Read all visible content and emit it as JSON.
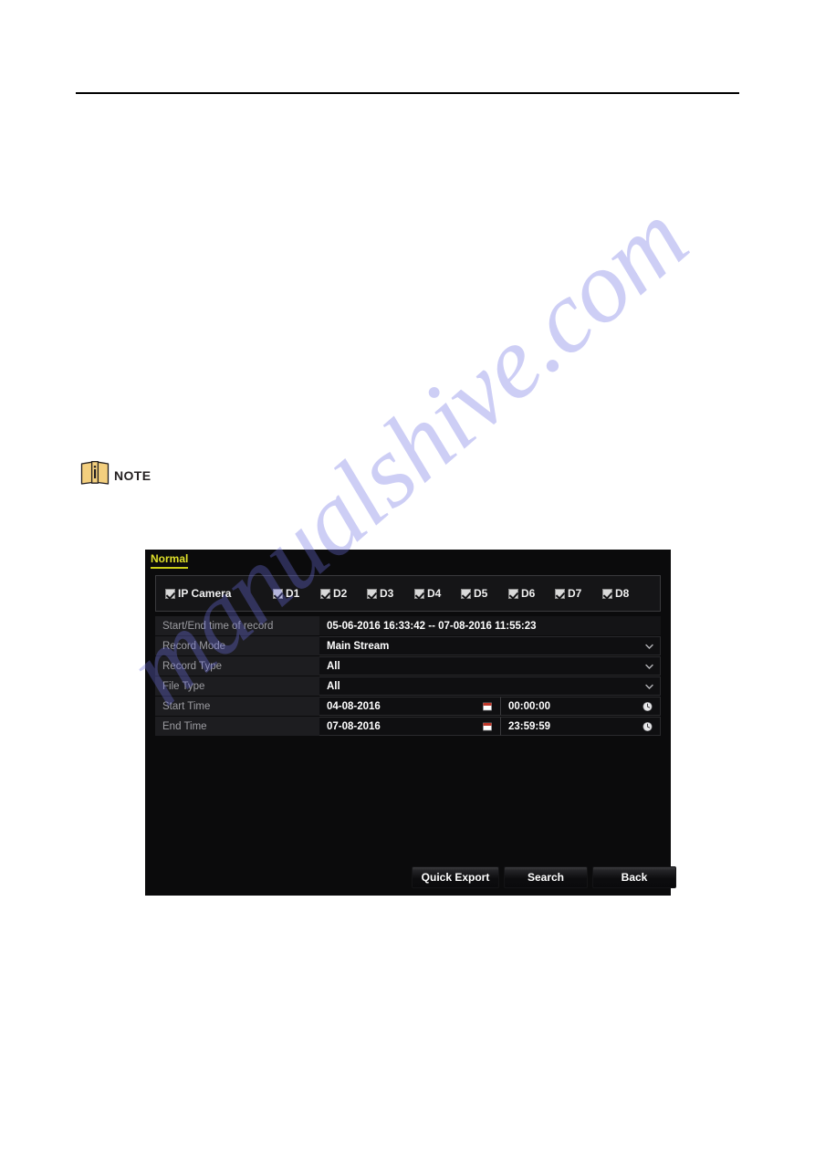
{
  "document": {
    "note_label": "NOTE",
    "note_icon": "book-info-icon",
    "watermark": "manualshive.com"
  },
  "nvr": {
    "tab": {
      "label": "Normal",
      "accent_color": "#dfe02a"
    },
    "cameras": {
      "group_label": "IP Camera",
      "group_checked": true,
      "channels": [
        {
          "label": "D1",
          "checked": true
        },
        {
          "label": "D2",
          "checked": true
        },
        {
          "label": "D3",
          "checked": true
        },
        {
          "label": "D4",
          "checked": true
        },
        {
          "label": "D5",
          "checked": true
        },
        {
          "label": "D6",
          "checked": true
        },
        {
          "label": "D7",
          "checked": true
        },
        {
          "label": "D8",
          "checked": true
        }
      ]
    },
    "fields": {
      "record_range_label": "Start/End time of record",
      "record_range_value": "05-06-2016 16:33:42 -- 07-08-2016 11:55:23",
      "record_mode_label": "Record Mode",
      "record_mode_value": "Main Stream",
      "record_type_label": "Record Type",
      "record_type_value": "All",
      "file_type_label": "File Type",
      "file_type_value": "All",
      "start_time_label": "Start Time",
      "start_time_date": "04-08-2016",
      "start_time_clock": "00:00:00",
      "end_time_label": "End Time",
      "end_time_date": "07-08-2016",
      "end_time_clock": "23:59:59"
    },
    "buttons": {
      "quick_export": "Quick Export",
      "search": "Search",
      "back": "Back"
    },
    "icons": {
      "dropdown": "chevron-down-icon",
      "calendar": "calendar-icon",
      "clock": "clock-icon"
    }
  }
}
